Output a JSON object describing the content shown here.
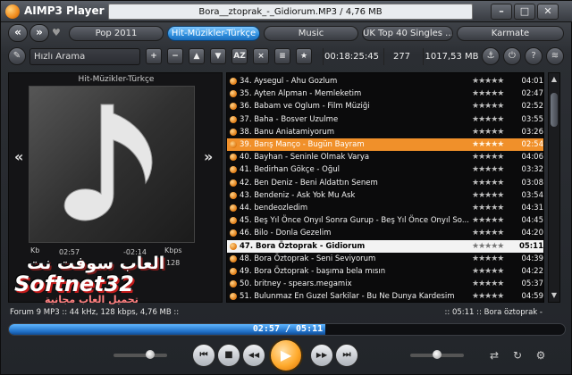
{
  "window": {
    "app_title": "AIMP3 Player",
    "now_playing": "Bora__ztoprak_-_Gidiorum.MP3 / 4,76 MB",
    "min_label": "–",
    "max_label": "□",
    "close_label": "✕"
  },
  "tabs": [
    {
      "label": "Pop 2011",
      "active": false
    },
    {
      "label": "Hit-Müzikler-Türkçe",
      "active": true
    },
    {
      "label": "Music",
      "active": false
    },
    {
      "label": "UK Top 40 Singles ...",
      "active": false
    },
    {
      "label": "Karmate",
      "active": false
    }
  ],
  "nav": {
    "back": "«",
    "forward": "»",
    "heart": "♥"
  },
  "toolbar": {
    "search_label": "Hızlı Arama",
    "buttons": [
      "+",
      "−",
      "▲",
      "▼",
      "AZ",
      "×",
      "≡",
      "★"
    ],
    "total_time": "00:18:25:45",
    "track_count": "277",
    "total_size": "1017,53 MB"
  },
  "left": {
    "album_label": "Hit-Müzikler-Türkçe",
    "prev": "«",
    "next": "»",
    "khz_label": "Kb",
    "elapsed_small": "02:57",
    "remaining_small": "-02:14",
    "kbps_label": "Kbps",
    "kbps": "128",
    "watermark_ar": "العاب سوفت نت",
    "watermark_brand": "Softnet32",
    "watermark_sub": "تحميل العاب مجانية"
  },
  "playlist": [
    {
      "text": "34. Aysegul - Ahu Gozlum",
      "duration": "04:01",
      "state": ""
    },
    {
      "text": "35. Ayten Alpman - Memleketim",
      "duration": "02:47",
      "state": ""
    },
    {
      "text": "36. Babam ve Oglum - Film Müziği",
      "duration": "02:52",
      "state": ""
    },
    {
      "text": "37. Baha - Bosver Uzulme",
      "duration": "03:55",
      "state": ""
    },
    {
      "text": "38. Banu Aniatamiyorum",
      "duration": "03:26",
      "state": ""
    },
    {
      "text": "39. Barış Manço - Bugün Bayram",
      "duration": "02:54",
      "state": "selected"
    },
    {
      "text": "40. Bayhan -  Seninle Olmak Varya",
      "duration": "04:06",
      "state": ""
    },
    {
      "text": "41. Bedirhan Gökçe - Oğul",
      "duration": "03:32",
      "state": ""
    },
    {
      "text": "42. Ben Deniz - Beni Aldattın Senem",
      "duration": "03:08",
      "state": ""
    },
    {
      "text": "43. Bendeniz - Ask Yok Mu Ask",
      "duration": "03:54",
      "state": ""
    },
    {
      "text": "44. bendeozledim",
      "duration": "04:31",
      "state": ""
    },
    {
      "text": "45. Beş Yıl Önce Onyıl Sonra Gurup - Beş Yıl Önce Onyıl So...",
      "duration": "04:45",
      "state": ""
    },
    {
      "text": "46. Bilo - Donla Gezelim",
      "duration": "04:20",
      "state": ""
    },
    {
      "text": "47. Bora Öztoprak - Gidiorum",
      "duration": "05:11",
      "state": "playing"
    },
    {
      "text": "48. Bora Öztoprak - Seni Seviyorum",
      "duration": "04:39",
      "state": ""
    },
    {
      "text": "49. Bora Öztoprak - başıma bela mısın",
      "duration": "04:22",
      "state": ""
    },
    {
      "text": "50. britney - spears.megamix",
      "duration": "05:37",
      "state": ""
    },
    {
      "text": "51. Bulunmaz En Guzel Sarkilar - Bu Ne Dunya Kardesim",
      "duration": "04:59",
      "state": ""
    }
  ],
  "status": {
    "left": "Forum 9 MP3 :: 44 kHz, 128 kbps, 4,76 MB ::",
    "right": ":: 05:11 :: Bora öztoprak -"
  },
  "progress": {
    "elapsed": "02:57",
    "total": "05:11",
    "fraction": 0.569
  },
  "controls": {
    "prev": "⏮",
    "stop": "■",
    "back": "◀◀",
    "play": "▶",
    "forward": "▶▶",
    "next": "⏭",
    "volume": 0.72,
    "balance": 0.5,
    "shuffle": "⇄",
    "repeat": "↻",
    "settings": "⚙"
  }
}
